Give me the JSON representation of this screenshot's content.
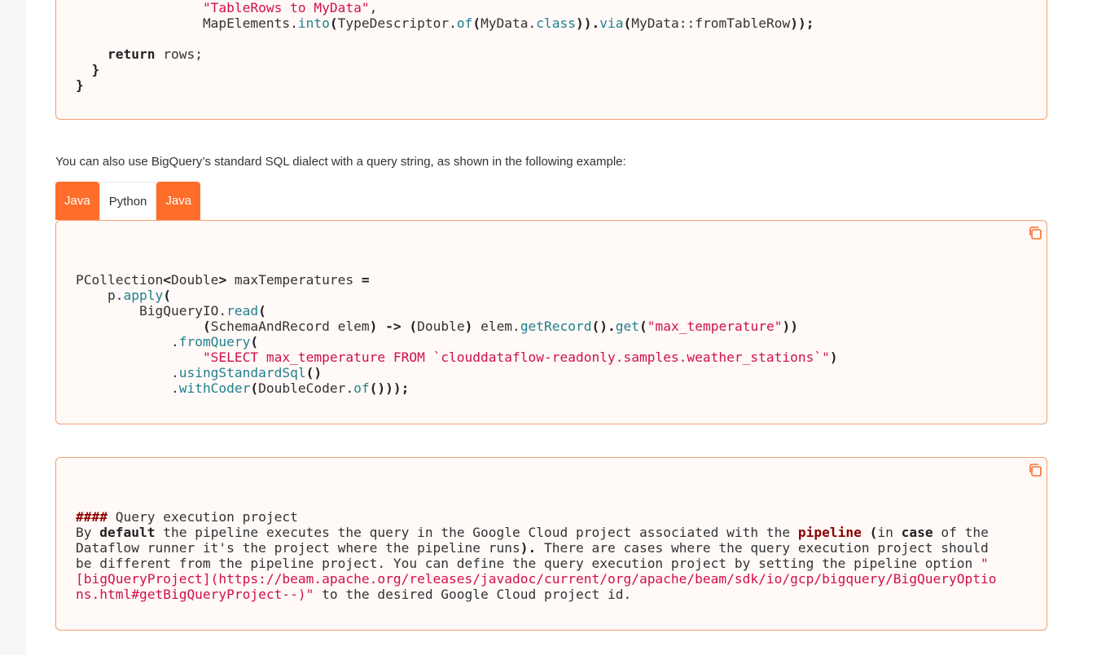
{
  "code_block_1": {
    "lines": [
      {
        "indent": "                ",
        "parts": [
          {
            "t": "\"TableRows to MyData\"",
            "c": "s"
          },
          {
            "t": ",",
            "c": ""
          }
        ]
      },
      {
        "indent": "                ",
        "parts": [
          {
            "t": "MapElements.",
            "c": ""
          },
          {
            "t": "into",
            "c": "m"
          },
          {
            "t": "(",
            "c": "p"
          },
          {
            "t": "TypeDescriptor.",
            "c": ""
          },
          {
            "t": "of",
            "c": "m"
          },
          {
            "t": "(",
            "c": "p"
          },
          {
            "t": "MyData.",
            "c": ""
          },
          {
            "t": "class",
            "c": "m"
          },
          {
            "t": ")).",
            "c": "p"
          },
          {
            "t": "via",
            "c": "m"
          },
          {
            "t": "(",
            "c": "p"
          },
          {
            "t": "MyData::fromTableRow",
            "c": ""
          },
          {
            "t": "));",
            "c": "p"
          }
        ]
      },
      {
        "indent": "",
        "parts": []
      },
      {
        "indent": "    ",
        "parts": [
          {
            "t": "return",
            "c": "k"
          },
          {
            "t": " rows;",
            "c": ""
          }
        ]
      },
      {
        "indent": "  ",
        "parts": [
          {
            "t": "}",
            "c": "k"
          }
        ]
      },
      {
        "indent": "",
        "parts": [
          {
            "t": "}",
            "c": "k"
          }
        ]
      }
    ]
  },
  "intro_text": "You can also use BigQuery’s standard SQL dialect with a query string, as shown in the following example:",
  "tabs": [
    {
      "label": "Java",
      "active": true
    },
    {
      "label": "Python",
      "active": false
    },
    {
      "label": "Java",
      "active": true
    }
  ],
  "code_block_2": {
    "lines": [
      {
        "indent": "",
        "parts": [
          {
            "t": "PCollection",
            "c": ""
          },
          {
            "t": "<",
            "c": "p"
          },
          {
            "t": "Double",
            "c": ""
          },
          {
            "t": ">",
            "c": "p"
          },
          {
            "t": " maxTemperatures ",
            "c": ""
          },
          {
            "t": "=",
            "c": "p"
          }
        ]
      },
      {
        "indent": "    ",
        "parts": [
          {
            "t": "p.",
            "c": ""
          },
          {
            "t": "apply",
            "c": "m"
          },
          {
            "t": "(",
            "c": "p"
          }
        ]
      },
      {
        "indent": "        ",
        "parts": [
          {
            "t": "BigQueryIO.",
            "c": ""
          },
          {
            "t": "read",
            "c": "m"
          },
          {
            "t": "(",
            "c": "p"
          }
        ]
      },
      {
        "indent": "                ",
        "parts": [
          {
            "t": "(",
            "c": "p"
          },
          {
            "t": "SchemaAndRecord elem",
            "c": ""
          },
          {
            "t": ") -> (",
            "c": "p"
          },
          {
            "t": "Double",
            "c": ""
          },
          {
            "t": ")",
            "c": "p"
          },
          {
            "t": " elem.",
            "c": ""
          },
          {
            "t": "getRecord",
            "c": "m"
          },
          {
            "t": "().",
            "c": "p"
          },
          {
            "t": "get",
            "c": "m"
          },
          {
            "t": "(",
            "c": "p"
          },
          {
            "t": "\"max_temperature\"",
            "c": "s"
          },
          {
            "t": "))",
            "c": "p"
          }
        ]
      },
      {
        "indent": "            ",
        "parts": [
          {
            "t": ".",
            "c": ""
          },
          {
            "t": "fromQuery",
            "c": "m"
          },
          {
            "t": "(",
            "c": "p"
          }
        ]
      },
      {
        "indent": "                ",
        "parts": [
          {
            "t": "\"SELECT max_temperature FROM `clouddataflow-readonly.samples.weather_stations`\"",
            "c": "s"
          },
          {
            "t": ")",
            "c": "p"
          }
        ]
      },
      {
        "indent": "            ",
        "parts": [
          {
            "t": ".",
            "c": ""
          },
          {
            "t": "usingStandardSql",
            "c": "m"
          },
          {
            "t": "()",
            "c": "p"
          }
        ]
      },
      {
        "indent": "            ",
        "parts": [
          {
            "t": ".",
            "c": ""
          },
          {
            "t": "withCoder",
            "c": "m"
          },
          {
            "t": "(",
            "c": "p"
          },
          {
            "t": "DoubleCoder.",
            "c": ""
          },
          {
            "t": "of",
            "c": "m"
          },
          {
            "t": "()));",
            "c": "p"
          }
        ]
      }
    ]
  },
  "code_block_3": {
    "lines": [
      {
        "indent": "",
        "parts": [
          {
            "t": "####",
            "c": "h"
          },
          {
            "t": " Query execution project",
            "c": ""
          }
        ]
      },
      {
        "indent": "",
        "parts": [
          {
            "t": "By ",
            "c": ""
          },
          {
            "t": "default",
            "c": "k"
          },
          {
            "t": " the pipeline executes the query in the Google Cloud project associated with the ",
            "c": ""
          },
          {
            "t": "pipeline",
            "c": "h"
          },
          {
            "t": " (",
            "c": "p"
          },
          {
            "t": "in ",
            "c": ""
          },
          {
            "t": "case",
            "c": "k"
          },
          {
            "t": " of the",
            "c": ""
          }
        ]
      },
      {
        "indent": "",
        "parts": [
          {
            "t": "Dataflow runner it's the project where the pipeline runs",
            "c": ""
          },
          {
            "t": ").",
            "c": "p"
          },
          {
            "t": " There are cases where the query execution project should",
            "c": ""
          }
        ]
      },
      {
        "indent": "",
        "parts": [
          {
            "t": "be different from the pipeline project. You can define the query execution project by setting the pipeline option ",
            "c": ""
          },
          {
            "t": "\"",
            "c": "s"
          }
        ]
      },
      {
        "indent": "",
        "parts": [
          {
            "t": "[bigQueryProject](https://beam.apache.org/releases/javadoc/current/org/apache/beam/sdk/io/gcp/bigquery/BigQueryOptio",
            "c": "s"
          }
        ]
      },
      {
        "indent": "",
        "parts": [
          {
            "t": "ns.html#getBigQueryProject--)\"",
            "c": "s"
          },
          {
            "t": " to the desired Google Cloud project id.",
            "c": ""
          }
        ]
      }
    ]
  },
  "colors": {
    "accent": "#ff6d2a",
    "code_bg": "#fff9f7",
    "code_border": "#f1a070",
    "string": "#d0104c",
    "method": "#21808c",
    "heading": "#8b0000"
  },
  "icons": {
    "copy": "copy-icon"
  }
}
